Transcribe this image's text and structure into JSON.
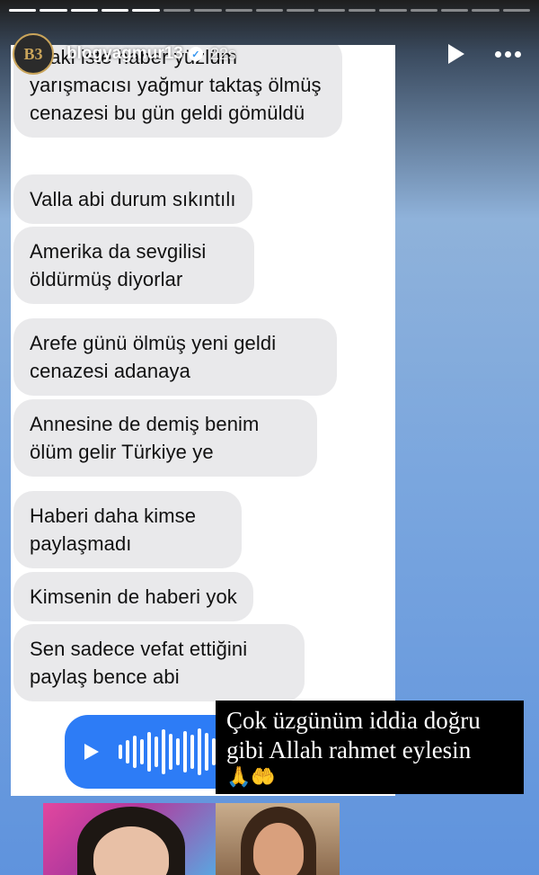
{
  "story": {
    "progress_segments_total": 17,
    "progress_segments_done": 5,
    "username": "blogyagmur13",
    "verified": true,
    "avatar_text": "B3",
    "time": "22s"
  },
  "chat": {
    "messages": [
      "i saki iste haber yüzlüm yarışmacısı yağmur taktaş ölmüş cenazesi bu gün geldi gömüldü",
      "Valla abi durum sıkıntılı",
      "Amerika da sevgilisi öldürmüş diyorlar",
      "Arefe günü ölmüş yeni geldi cenazesi adanaya",
      "Annesine de demiş benim ölüm gelir Türkiye ye",
      "Haberi daha kimse paylaşmadı",
      "Kimsenin de haberi yok",
      "Sen sadece vefat ettiğini paylaş bence abi"
    ],
    "voice_message": {
      "icon": "play-icon"
    }
  },
  "caption": {
    "text": "Çok üzgünüm iddia doğru gibi Allah rahmet eylesin",
    "emoji": "🙏🤲"
  },
  "colors": {
    "bubble_bg": "#e9e9eb",
    "voice_bg": "#2d7cf6",
    "caption_bg": "#000000"
  }
}
